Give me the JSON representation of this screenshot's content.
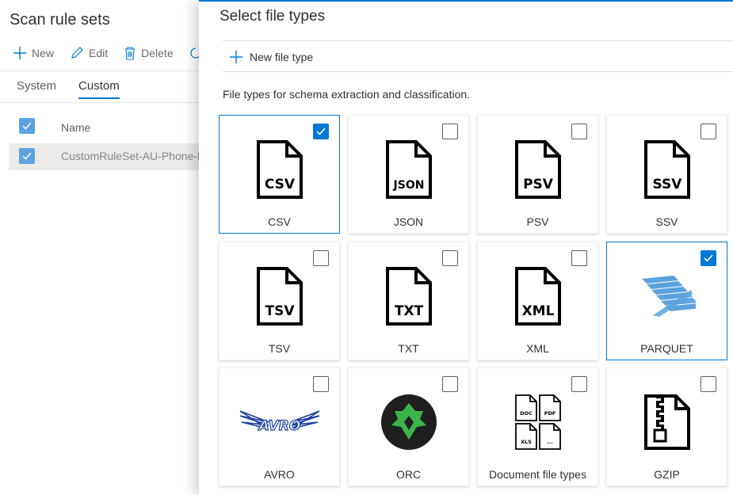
{
  "background": {
    "title": "Scan rule sets",
    "toolbar": {
      "new": "New",
      "edit": "Edit",
      "delete": "Delete"
    },
    "tabs": [
      "System",
      "Custom"
    ],
    "active_tab": "Custom",
    "table": {
      "name_header": "Name",
      "row": "CustomRuleSet-AU-Phone-N"
    }
  },
  "panel": {
    "title": "Select file types",
    "new_file_type": "New file type",
    "description": "File types for schema extraction and classification.",
    "tiles": [
      {
        "label": "CSV",
        "icon": "csv-file-icon",
        "icon_text": "CSV",
        "checked": true
      },
      {
        "label": "JSON",
        "icon": "json-file-icon",
        "icon_text": "JSON",
        "checked": false
      },
      {
        "label": "PSV",
        "icon": "psv-file-icon",
        "icon_text": "PSV",
        "checked": false
      },
      {
        "label": "SSV",
        "icon": "ssv-file-icon",
        "icon_text": "SSV",
        "checked": false
      },
      {
        "label": "TSV",
        "icon": "tsv-file-icon",
        "icon_text": "TSV",
        "checked": false
      },
      {
        "label": "TXT",
        "icon": "txt-file-icon",
        "icon_text": "TXT",
        "checked": false
      },
      {
        "label": "XML",
        "icon": "xml-file-icon",
        "icon_text": "XML",
        "checked": false
      },
      {
        "label": "PARQUET",
        "icon": "parquet-logo-icon",
        "checked": true
      },
      {
        "label": "AVRO",
        "icon": "avro-logo-icon",
        "icon_text": "AVRO",
        "checked": false
      },
      {
        "label": "ORC",
        "icon": "orc-logo-icon",
        "checked": false
      },
      {
        "label": "Document file types",
        "icon": "document-file-types-icon",
        "doc_types": [
          "DOC",
          "PDF",
          "XLS",
          "..."
        ],
        "checked": false
      },
      {
        "label": "GZIP",
        "icon": "gzip-file-icon",
        "checked": false
      }
    ]
  },
  "colors": {
    "accent": "#0078d4",
    "parquet": "#5ba3de",
    "orc_bg": "#1f1f1f",
    "orc_green": "#3bb54a",
    "avro": "#1a3d9e"
  }
}
